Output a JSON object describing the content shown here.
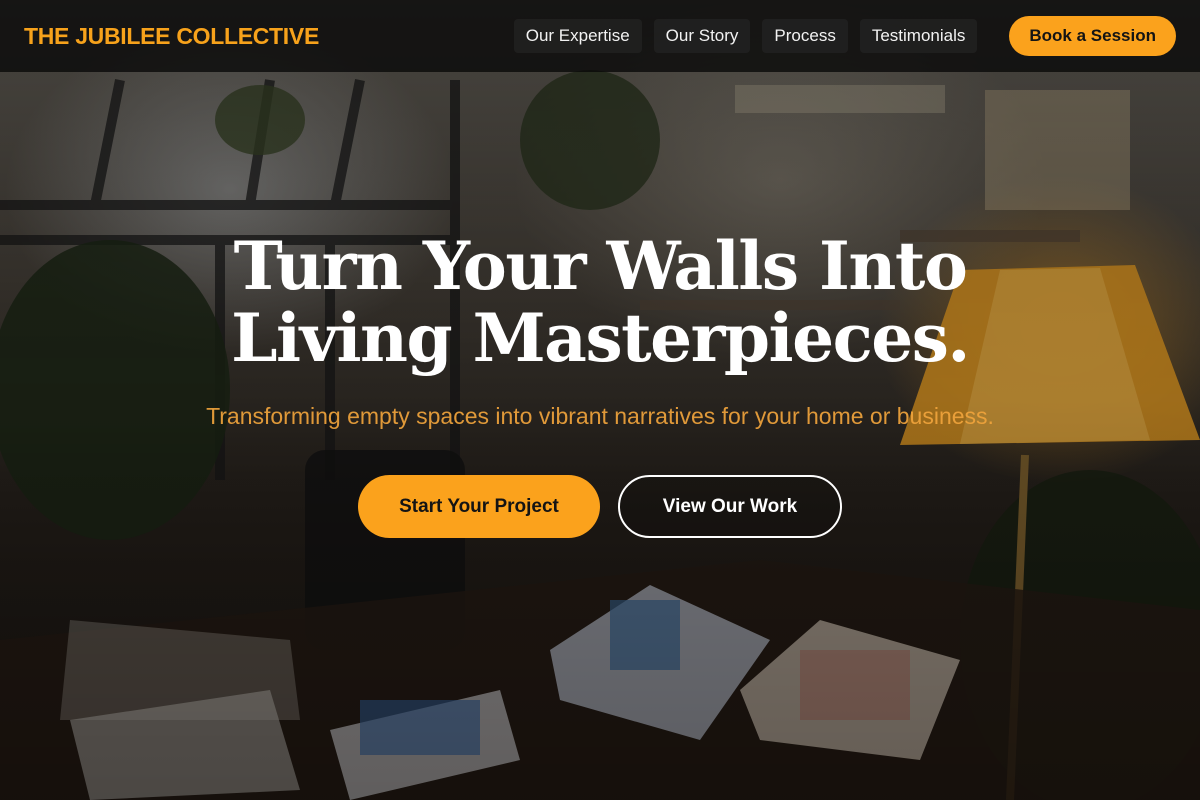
{
  "brand": {
    "name": "THE JUBILEE COLLECTIVE"
  },
  "nav": {
    "items": [
      {
        "label": "Our Expertise"
      },
      {
        "label": "Our Story"
      },
      {
        "label": "Process"
      },
      {
        "label": "Testimonials"
      }
    ],
    "cta_label": "Book a Session"
  },
  "hero": {
    "title_line1": "Turn Your Walls Into",
    "title_line2": "Living Masterpieces.",
    "subtitle": "Transforming empty spaces into vibrant narratives for your home or business.",
    "primary_button": "Start Your Project",
    "secondary_button": "View Our Work"
  },
  "colors": {
    "accent": "#fba21c",
    "brand_text": "#f7a21b",
    "header_bg": "#080808",
    "title": "#ffffff"
  },
  "background": {
    "description_icon": "art-studio-photo"
  }
}
